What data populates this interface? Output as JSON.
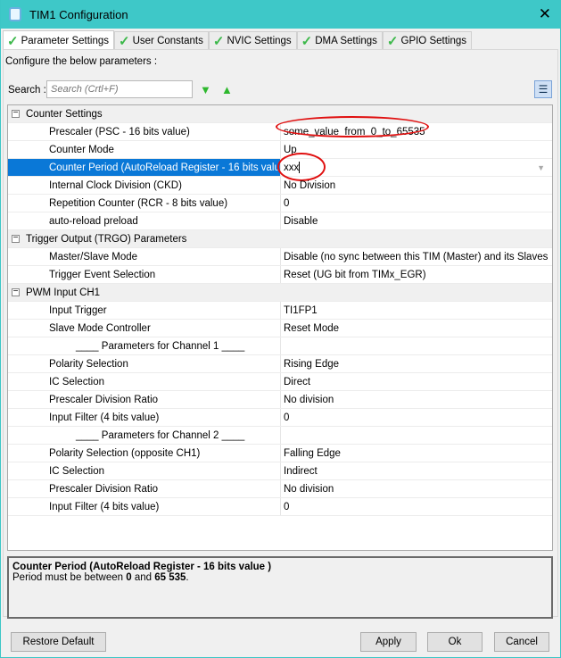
{
  "window": {
    "title": "TIM1 Configuration"
  },
  "tabs": [
    "Parameter Settings",
    "User Constants",
    "NVIC Settings",
    "DMA Settings",
    "GPIO Settings"
  ],
  "configure_label": "Configure the below parameters :",
  "search": {
    "label": "Search :",
    "placeholder": "Search (Crtl+F)"
  },
  "rows": [
    {
      "type": "group",
      "label": "Counter Settings"
    },
    {
      "label": "Prescaler (PSC - 16 bits value)",
      "value": "some_value_from_0_to_65535"
    },
    {
      "label": "Counter Mode",
      "value": "Up"
    },
    {
      "label": "Counter Period (AutoReload Register - 16 bits value )",
      "value": "xxx",
      "selected": true
    },
    {
      "label": "Internal Clock Division (CKD)",
      "value": "No Division"
    },
    {
      "label": "Repetition Counter (RCR - 8 bits value)",
      "value": "0"
    },
    {
      "label": "auto-reload preload",
      "value": "Disable"
    },
    {
      "type": "group",
      "label": "Trigger Output (TRGO) Parameters"
    },
    {
      "label": "Master/Slave Mode",
      "value": "Disable (no sync between this TIM (Master) and its Slaves"
    },
    {
      "label": "Trigger Event Selection",
      "value": "Reset (UG bit from TIMx_EGR)"
    },
    {
      "type": "group",
      "label": "PWM Input CH1"
    },
    {
      "label": "Input Trigger",
      "value": " TI1FP1"
    },
    {
      "label": "Slave Mode Controller",
      "value": "Reset Mode"
    },
    {
      "type": "sub",
      "label": "____ Parameters for Channel 1 ____",
      "value": ""
    },
    {
      "label": "Polarity Selection",
      "value": "Rising Edge"
    },
    {
      "label": "IC Selection",
      "value": "Direct"
    },
    {
      "label": "Prescaler Division Ratio",
      "value": "No division"
    },
    {
      "label": "Input Filter (4 bits value)",
      "value": "0"
    },
    {
      "type": "sub",
      "label": "____ Parameters for Channel 2 ____",
      "value": ""
    },
    {
      "label": "Polarity Selection (opposite CH1)",
      "value": "Falling Edge"
    },
    {
      "label": "IC Selection",
      "value": "Indirect"
    },
    {
      "label": "Prescaler Division Ratio",
      "value": "No division"
    },
    {
      "label": "Input Filter (4 bits value)",
      "value": "0"
    }
  ],
  "description": {
    "title": "Counter Period (AutoReload Register - 16 bits value )",
    "prefix": "Period must be between ",
    "min": "0",
    "mid": " and ",
    "max": "65 535",
    "suffix": "."
  },
  "buttons": {
    "restore": "Restore Default",
    "apply": "Apply",
    "ok": "Ok",
    "cancel": "Cancel"
  }
}
